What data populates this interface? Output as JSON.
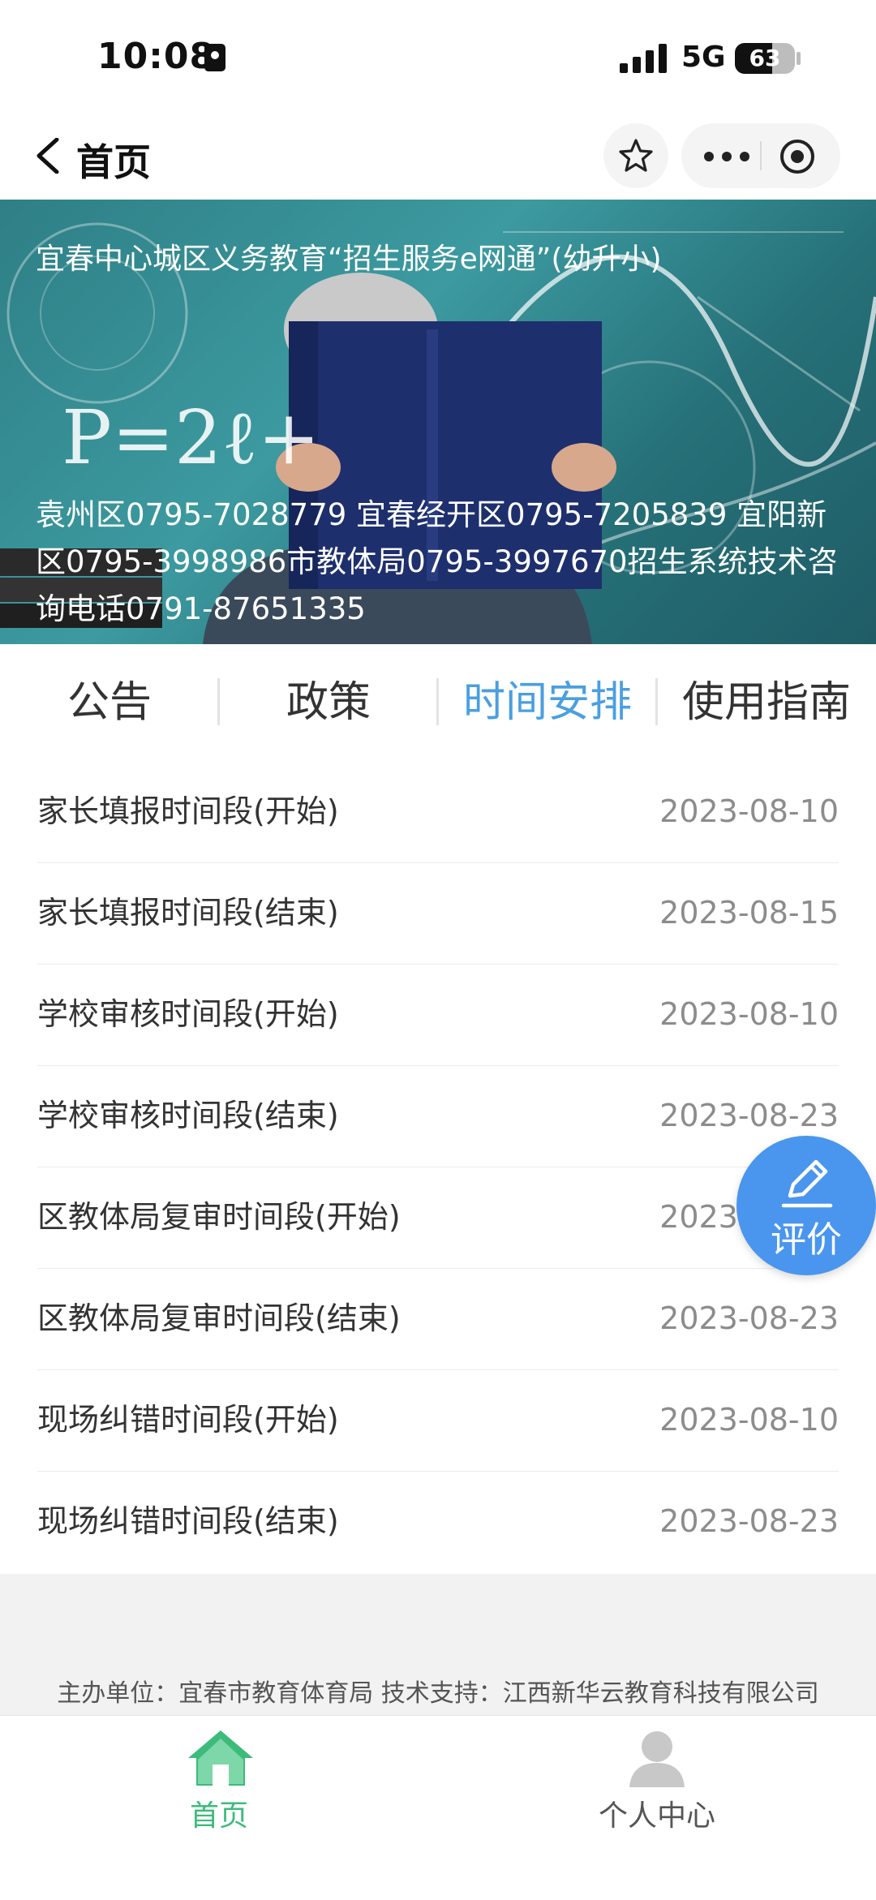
{
  "status_bar": {
    "time": "10:08",
    "network": "5G",
    "battery": "63"
  },
  "nav": {
    "back_label": "首页"
  },
  "banner": {
    "title": "宜春中心城区义务教育“招生服务e网通”(幼升小)",
    "formula": "P=2ℓ+",
    "contact": "袁州区0795-7028779 宜春经开区0795-7205839 宜阳新区0795-3998986市教体局0795-3997670招生系统技术咨询电话0791-87651335"
  },
  "tabs": [
    {
      "label": "公告",
      "active": false
    },
    {
      "label": "政策",
      "active": false
    },
    {
      "label": "时间安排",
      "active": true
    },
    {
      "label": "使用指南",
      "active": false
    }
  ],
  "schedule": [
    {
      "label": "家长填报时间段(开始)",
      "date": "2023-08-10"
    },
    {
      "label": "家长填报时间段(结束)",
      "date": "2023-08-15"
    },
    {
      "label": "学校审核时间段(开始)",
      "date": "2023-08-10"
    },
    {
      "label": "学校审核时间段(结束)",
      "date": "2023-08-23"
    },
    {
      "label": "区教体局复审时间段(开始)",
      "date": "2023-08-10"
    },
    {
      "label": "区教体局复审时间段(结束)",
      "date": "2023-08-23"
    },
    {
      "label": "现场纠错时间段(开始)",
      "date": "2023-08-10"
    },
    {
      "label": "现场纠错时间段(结束)",
      "date": "2023-08-23"
    }
  ],
  "rate_button": {
    "label": "评价"
  },
  "footer": {
    "text": "主办单位：宜春市教育体育局 技术支持：江西新华云教育科技有限公司"
  },
  "tabbar": {
    "home_label": "首页",
    "profile_label": "个人中心"
  },
  "colors": {
    "active_tab": "#4a9fe0",
    "home_green": "#3dbb7b",
    "rate_blue": "#4a96ee",
    "banner_teal": "#3c9aa0"
  },
  "icons": [
    "lock-icon",
    "signal-icon",
    "battery-icon",
    "back-icon",
    "star-icon",
    "more-icon",
    "target-icon",
    "pen-icon",
    "home-icon",
    "person-icon"
  ]
}
